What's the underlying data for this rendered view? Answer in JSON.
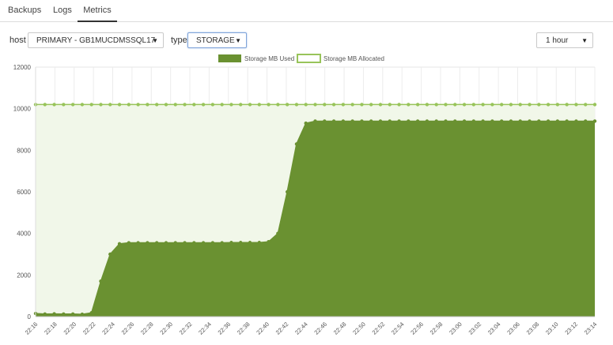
{
  "tabs": [
    {
      "label": "Backups",
      "active": false
    },
    {
      "label": "Logs",
      "active": false
    },
    {
      "label": "Metrics",
      "active": true
    }
  ],
  "filters": {
    "host_label": "host",
    "host_value": "PRIMARY - GB1MUCDMSSQL17",
    "type_label": "type",
    "type_value": "STORAGE",
    "range_value": "1 hour"
  },
  "colors": {
    "used": "#6a9131",
    "allocated": "#98c45a",
    "allocated_fill": "#f1f7e9"
  },
  "chart_data": {
    "type": "area",
    "x": [
      "22:16",
      "22:18",
      "22:20",
      "22:22",
      "22:24",
      "22:26",
      "22:28",
      "22:30",
      "22:32",
      "22:34",
      "22:36",
      "22:38",
      "22:40",
      "22:42",
      "22:44",
      "22:46",
      "22:48",
      "22:50",
      "22:52",
      "22:54",
      "22:56",
      "22:58",
      "23:00",
      "23:02",
      "23:04",
      "23:06",
      "23:08",
      "23:10",
      "23:12",
      "23:14"
    ],
    "series": [
      {
        "name": "Storage MB Used",
        "values": [
          150,
          120,
          130,
          120,
          120,
          110,
          180,
          1700,
          3000,
          3500,
          3550,
          3550,
          3550,
          3550,
          3550,
          3550,
          3550,
          3550,
          3550,
          3550,
          3550,
          3560,
          3560,
          3560,
          3560,
          3600,
          4000,
          6000,
          8300,
          9300,
          9400,
          9400,
          9400,
          9400,
          9400,
          9400,
          9400,
          9400,
          9400,
          9400,
          9400,
          9400,
          9400,
          9400,
          9400,
          9400,
          9400,
          9400,
          9400,
          9400,
          9400,
          9400,
          9400,
          9400,
          9400,
          9400,
          9400,
          9400,
          9400,
          9400,
          9400
        ]
      },
      {
        "name": "Storage MB Allocated",
        "values": [
          10200,
          10200,
          10200,
          10200,
          10200,
          10200,
          10200,
          10200,
          10200,
          10200,
          10200,
          10200,
          10200,
          10200,
          10200,
          10200,
          10200,
          10200,
          10200,
          10200,
          10200,
          10200,
          10200,
          10200,
          10200,
          10200,
          10200,
          10200,
          10200,
          10200,
          10200,
          10200,
          10200,
          10200,
          10200,
          10200,
          10200,
          10200,
          10200,
          10200,
          10200,
          10200,
          10200,
          10200,
          10200,
          10200,
          10200,
          10200,
          10200,
          10200,
          10200,
          10200,
          10200,
          10200,
          10200,
          10200,
          10200,
          10200,
          10200,
          10200,
          10200
        ]
      }
    ],
    "x_ticks": [
      "22:16",
      "22:18",
      "22:20",
      "22:22",
      "22:24",
      "22:26",
      "22:28",
      "22:30",
      "22:32",
      "22:34",
      "22:36",
      "22:38",
      "22:40",
      "22:42",
      "22:44",
      "22:46",
      "22:48",
      "22:50",
      "22:52",
      "22:54",
      "22:56",
      "22:58",
      "23:00",
      "23:02",
      "23:04",
      "23:06",
      "23:08",
      "23:10",
      "23:12",
      "23:14"
    ],
    "y_ticks": [
      "0",
      "2000",
      "4000",
      "6000",
      "8000",
      "10000",
      "12000"
    ],
    "ylim": [
      0,
      12000
    ],
    "legend_position": "top-center",
    "grid": true
  }
}
